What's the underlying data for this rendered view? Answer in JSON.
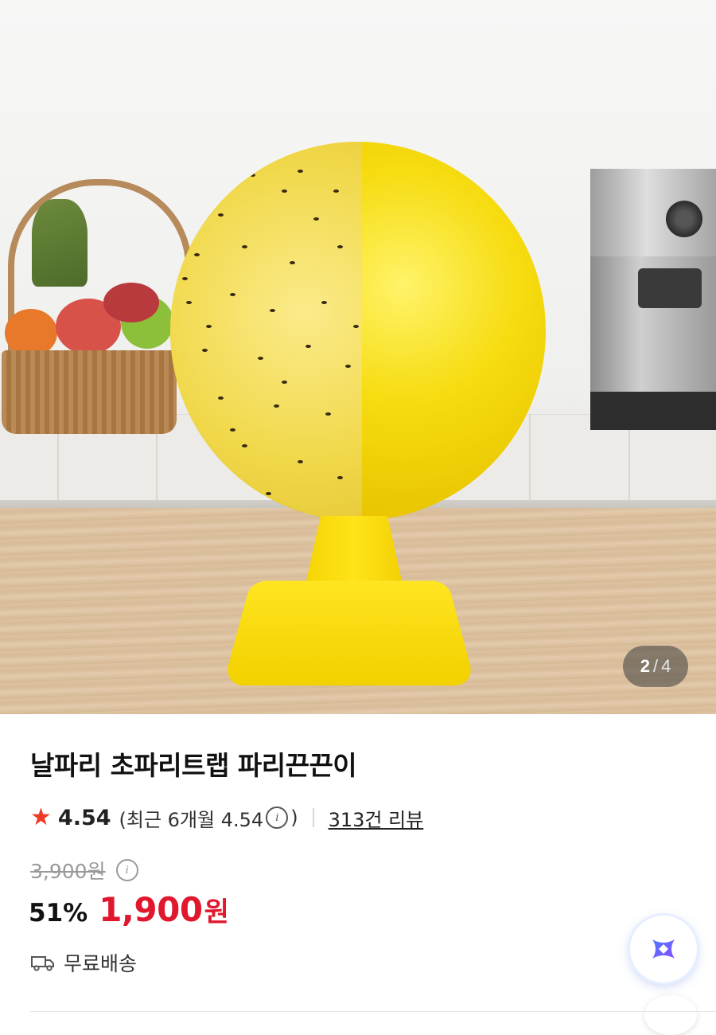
{
  "gallery": {
    "current_page": "2",
    "separator": "/",
    "total_pages": "4"
  },
  "product": {
    "title": "날파리 초파리트랩 파리끈끈이",
    "rating": {
      "score": "4.54",
      "recent_prefix": "(최근 6개월 4.54",
      "recent_suffix": ")",
      "review_count": "313건 리뷰"
    },
    "original_price": "3,900원",
    "discount_rate": "51%",
    "sale_price": "1,900",
    "sale_price_unit": "원",
    "shipping": "무료배송"
  },
  "colors": {
    "sale_price": "#e0172d",
    "star": "#f03a26"
  },
  "icons": {
    "star": "star-icon",
    "info": "info-icon",
    "truck": "truck-icon",
    "assistant": "ai-assistant-icon"
  }
}
